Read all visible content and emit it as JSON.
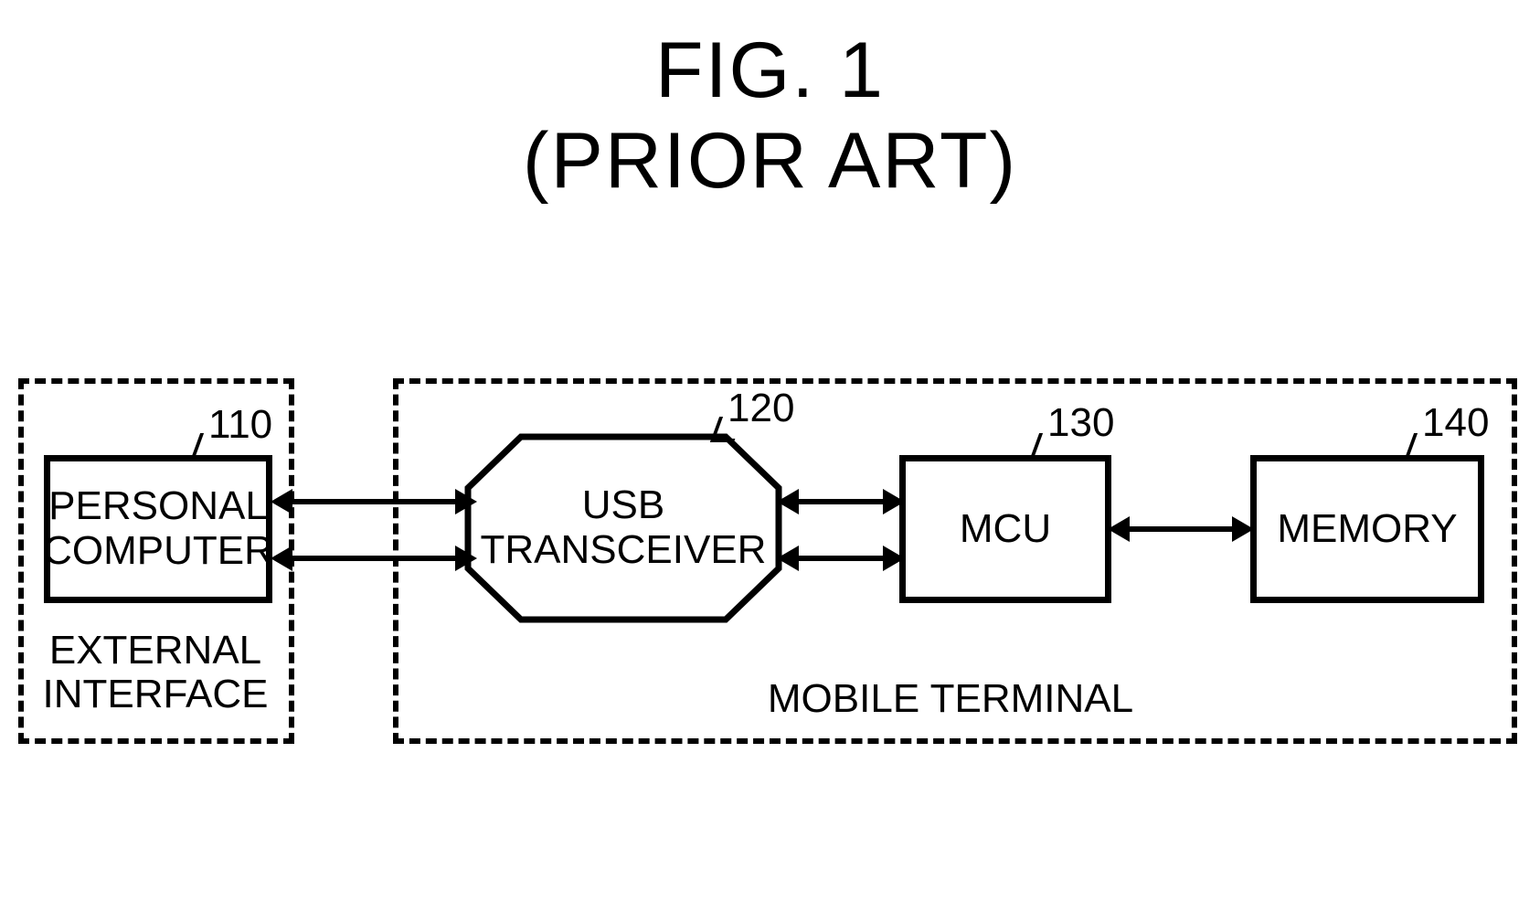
{
  "title": {
    "line1": "FIG. 1",
    "line2": "(PRIOR ART)"
  },
  "groups": {
    "external": "EXTERNAL\nINTERFACE",
    "mobile": "MOBILE TERMINAL"
  },
  "blocks": {
    "pc": {
      "label": "PERSONAL\nCOMPUTER",
      "ref": "110"
    },
    "usb": {
      "label": "USB\nTRANSCEIVER",
      "ref": "120"
    },
    "mcu": {
      "label": "MCU",
      "ref": "130"
    },
    "memory": {
      "label": "MEMORY",
      "ref": "140"
    }
  }
}
